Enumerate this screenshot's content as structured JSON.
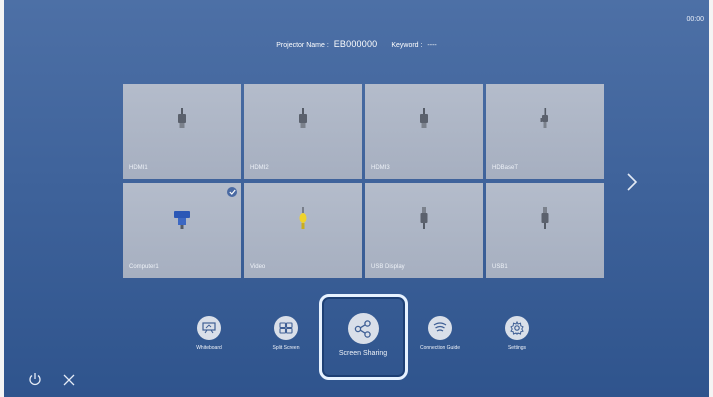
{
  "clock": "00:00",
  "header": {
    "name_label": "Projector Name :",
    "name_value": "EB000000",
    "keyword_label": "Keyword :",
    "keyword_value": "----"
  },
  "sources": [
    {
      "label": "HDMI1",
      "icon": "hdmi-icon",
      "selected": false
    },
    {
      "label": "HDMI2",
      "icon": "hdmi-icon",
      "selected": false
    },
    {
      "label": "HDMI3",
      "icon": "hdmi-icon",
      "selected": false
    },
    {
      "label": "HDBaseT",
      "icon": "hdbaset-icon",
      "selected": false
    },
    {
      "label": "Computer1",
      "icon": "vga-icon",
      "selected": true
    },
    {
      "label": "Video",
      "icon": "rca-video-icon",
      "selected": false
    },
    {
      "label": "USB Display",
      "icon": "usb-icon",
      "selected": false
    },
    {
      "label": "USB1",
      "icon": "usb-icon",
      "selected": false
    }
  ],
  "dock": [
    {
      "label": "Whiteboard",
      "icon": "whiteboard-icon",
      "selected": false
    },
    {
      "label": "Split Screen",
      "icon": "split-screen-icon",
      "selected": false
    },
    {
      "label": "Screen Sharing",
      "icon": "share-icon",
      "selected": true
    },
    {
      "label": "Connection Guide",
      "icon": "wireless-icon",
      "selected": false
    },
    {
      "label": "Settings",
      "icon": "gear-icon",
      "selected": false
    }
  ],
  "colors": {
    "background": "#3f639b",
    "tile": "#aab3c3",
    "check": "#4a6aa3",
    "vga_blue": "#2b57b6",
    "rca_yellow": "#f0d32a"
  },
  "controls": {
    "power_icon": "power-icon",
    "close_icon": "close-icon",
    "next_icon": "chevron-right-icon"
  }
}
